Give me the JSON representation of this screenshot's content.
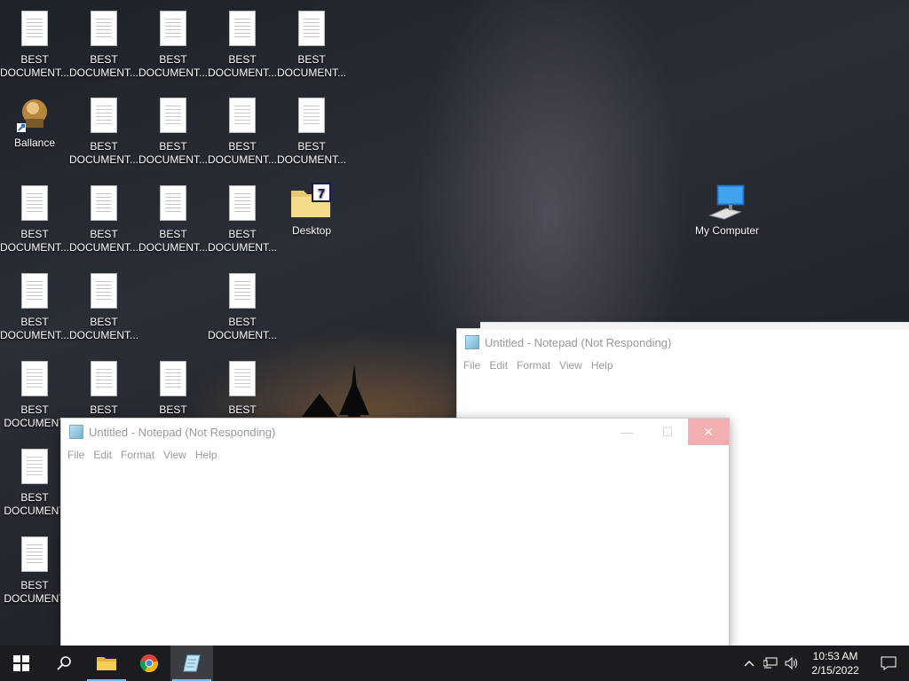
{
  "desktop": {
    "doc_label": "BEST DOCUMENT...",
    "doc_label_line1": "BEST",
    "doc_label_line2": "DOCUMENT...",
    "doc_label_line2_cut": "DOCUMENT",
    "ballance_label": "Ballance",
    "desktop_folder_label": "Desktop",
    "my_computer_label": "My Computer"
  },
  "window_back": {
    "title": "Untitled - Notepad (Not Responding)",
    "menu": [
      "File",
      "Edit",
      "Format",
      "View",
      "Help"
    ]
  },
  "window_front": {
    "title": "Untitled - Notepad (Not Responding)",
    "menu": [
      "File",
      "Edit",
      "Format",
      "View",
      "Help"
    ],
    "minimize_glyph": "—",
    "maximize_glyph": "☐",
    "close_glyph": "✕"
  },
  "taskbar": {
    "time": "10:53 AM",
    "date": "2/15/2022",
    "icons": [
      "windows-start-icon",
      "search-icon",
      "file-explorer-icon",
      "chrome-icon",
      "notepad-icon"
    ],
    "tray_icons": [
      "chevron-up-icon",
      "network-icon",
      "volume-icon",
      "notification-icon"
    ]
  },
  "colors": {
    "taskbar_bg": "#1b1c1f",
    "close_hover": "#f3aeb2",
    "active_underline": "#76b9ed"
  }
}
